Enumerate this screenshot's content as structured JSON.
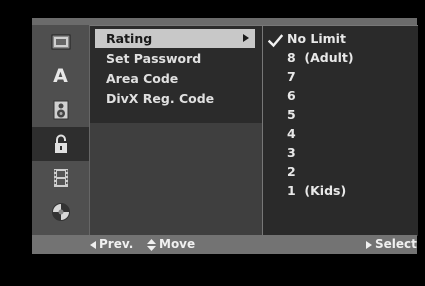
{
  "sidebar": {
    "icons": [
      {
        "name": "disc-menu-icon",
        "active": false
      },
      {
        "name": "language-icon",
        "glyph": "A",
        "active": false
      },
      {
        "name": "speaker-icon",
        "active": false
      },
      {
        "name": "lock-icon",
        "active": true
      },
      {
        "name": "film-icon",
        "active": false
      },
      {
        "name": "others-disc-icon",
        "active": false
      }
    ]
  },
  "categories": {
    "items": [
      {
        "label": "Rating",
        "selected": true
      },
      {
        "label": "Set Password",
        "selected": false
      },
      {
        "label": "Area Code",
        "selected": false
      },
      {
        "label": "DivX Reg. Code",
        "selected": false
      }
    ]
  },
  "options": {
    "items": [
      {
        "label": "No Limit",
        "checked": true
      },
      {
        "label": "8  (Adult)"
      },
      {
        "label": "7"
      },
      {
        "label": "6"
      },
      {
        "label": "5"
      },
      {
        "label": "4"
      },
      {
        "label": "3"
      },
      {
        "label": "2"
      },
      {
        "label": "1  (Kids)"
      }
    ]
  },
  "footer": {
    "prev_label": "Prev.",
    "move_label": "Move",
    "select_label": "Select"
  },
  "colors": {
    "frame": "#4a4a4a",
    "highlight": "#c8c8c8",
    "footer": "#737373"
  }
}
